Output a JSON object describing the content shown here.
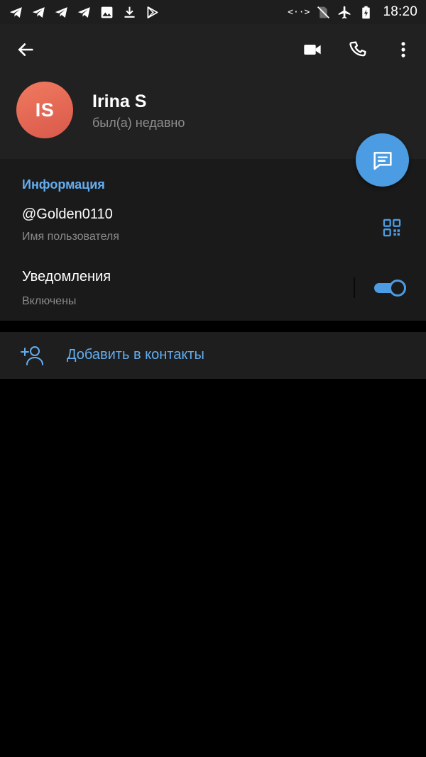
{
  "status_bar": {
    "time": "18:20",
    "left_icons": [
      "telegram-icon",
      "telegram-icon",
      "telegram-icon",
      "telegram-icon",
      "image-icon",
      "download-icon",
      "play-store-icon"
    ],
    "right_icons": [
      "data-saver-icon",
      "no-sim-icon",
      "airplane-icon",
      "battery-charging-icon"
    ]
  },
  "toolbar": {
    "icons": [
      "back-arrow-icon",
      "video-call-icon",
      "phone-icon",
      "more-vertical-icon"
    ]
  },
  "profile": {
    "initials": "IS",
    "name": "Irina S",
    "status": "был(а) недавно",
    "avatar_colors": [
      "#f07a5f",
      "#d9594b"
    ]
  },
  "fab": {
    "icon": "message-icon"
  },
  "info": {
    "section_title": "Информация",
    "username": "@Golden0110",
    "username_label": "Имя пользователя",
    "qr_icon": "qr-code-icon",
    "notifications_title": "Уведомления",
    "notifications_state": "Включены",
    "notifications_enabled": true
  },
  "actions": {
    "add_contact_label": "Добавить в контакты",
    "add_contact_icon": "add-person-icon"
  },
  "colors": {
    "accent": "#4b9ce2",
    "accent_text": "#64aef0",
    "header_bg": "#212121",
    "section_bg": "#1a1a1a",
    "page_bg": "#000000"
  }
}
